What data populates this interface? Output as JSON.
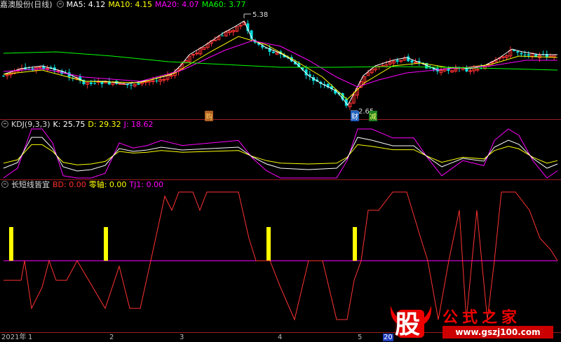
{
  "main": {
    "title": "嘉澳股份(日线)",
    "indicators": [
      {
        "label": "MA5: 4.12",
        "color": "#ffffff"
      },
      {
        "label": "MA10: 4.15",
        "color": "#ffff00"
      },
      {
        "label": "MA20: 4.07",
        "color": "#ff00ff"
      },
      {
        "label": "MA60: 3.77",
        "color": "#00ff00"
      }
    ],
    "high_label": "5.38",
    "low_label": "2.65",
    "tags": [
      {
        "text": "购",
        "bg": "#b06020",
        "fg": "#ffcc66"
      },
      {
        "text": "财",
        "bg": "#2060c0",
        "fg": "#ffffff"
      },
      {
        "text": "减",
        "bg": "#208020",
        "fg": "#ffff66"
      }
    ]
  },
  "kdj": {
    "title": "KDJ(9,3,3)",
    "indicators": [
      {
        "label": "K: 25.75",
        "color": "#ffffff"
      },
      {
        "label": "D: 29.32",
        "color": "#ffff00"
      },
      {
        "label": "J: 18.62",
        "color": "#ff00ff"
      }
    ]
  },
  "cx": {
    "title": "长短线皆宜",
    "indicators": [
      {
        "label": "BD: 0.00",
        "color": "#ff3030"
      },
      {
        "label": "零轴: 0.00",
        "color": "#ffff00"
      },
      {
        "label": "TJ1: 0.00",
        "color": "#ff00ff"
      }
    ]
  },
  "axis": {
    "labels": [
      "2021年",
      "1",
      "2",
      "3",
      "4",
      "5",
      "20"
    ]
  },
  "colors": {
    "up": "#ff3232",
    "down": "#00e0e0",
    "ma5": "#ffffff",
    "ma10": "#ffff00",
    "ma20": "#ff00ff",
    "ma60": "#00ff00",
    "separator": "#9b1b1b"
  },
  "watermark": {
    "big_char": "股",
    "title": "公式之家",
    "url": "www.gszj100.com"
  }
}
